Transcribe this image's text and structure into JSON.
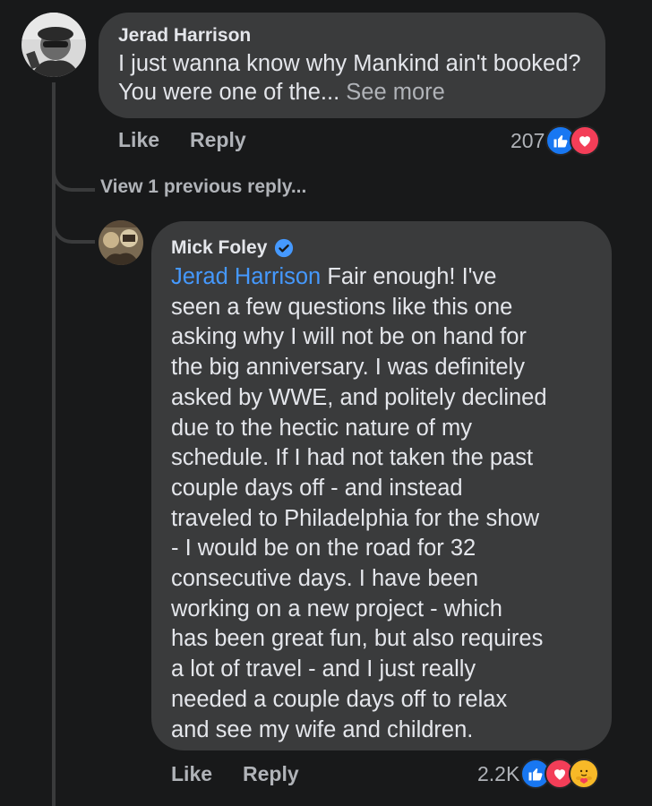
{
  "comment1": {
    "author": "Jerad Harrison",
    "text": "I just wanna know why Mankind ain't booked? You were one of the...",
    "see_more": "See more",
    "like_label": "Like",
    "reply_label": "Reply",
    "reaction_count": "207",
    "reactions": [
      "like-reaction-icon",
      "love-reaction-icon"
    ]
  },
  "view_previous": "View 1 previous reply...",
  "reply1": {
    "author": "Mick Foley",
    "verified_icon": "verified-badge-icon",
    "mention": "Jerad Harrison",
    "lines": [
      " Fair enough! I've",
      "seen a few questions like this one",
      "asking why I will not be on hand for",
      "the big anniversary. I was definitely",
      "asked by WWE, and politely declined",
      "due to the hectic nature of my",
      "schedule. If I had not taken the past",
      "couple days off - and instead",
      "traveled to Philadelphia for the show",
      "- I would be on the road for 32",
      "consecutive days. I have been",
      "working on a new project - which",
      "has been great fun, but also requires",
      "a lot of travel - and I just really",
      "needed a couple days off to relax",
      "and see my wife and children."
    ],
    "like_label": "Like",
    "reply_label": "Reply",
    "reaction_count": "2.2K",
    "reactions": [
      "like-reaction-icon",
      "love-reaction-icon",
      "care-reaction-icon"
    ]
  },
  "colors": {
    "background": "#18191a",
    "bubble": "#3a3b3c",
    "text": "#e4e6eb",
    "secondary": "#b0b3b8",
    "mention": "#4599ff",
    "like_blue": "#1877f2",
    "love_red": "#f33e58",
    "care_yellow": "#f7b928"
  }
}
